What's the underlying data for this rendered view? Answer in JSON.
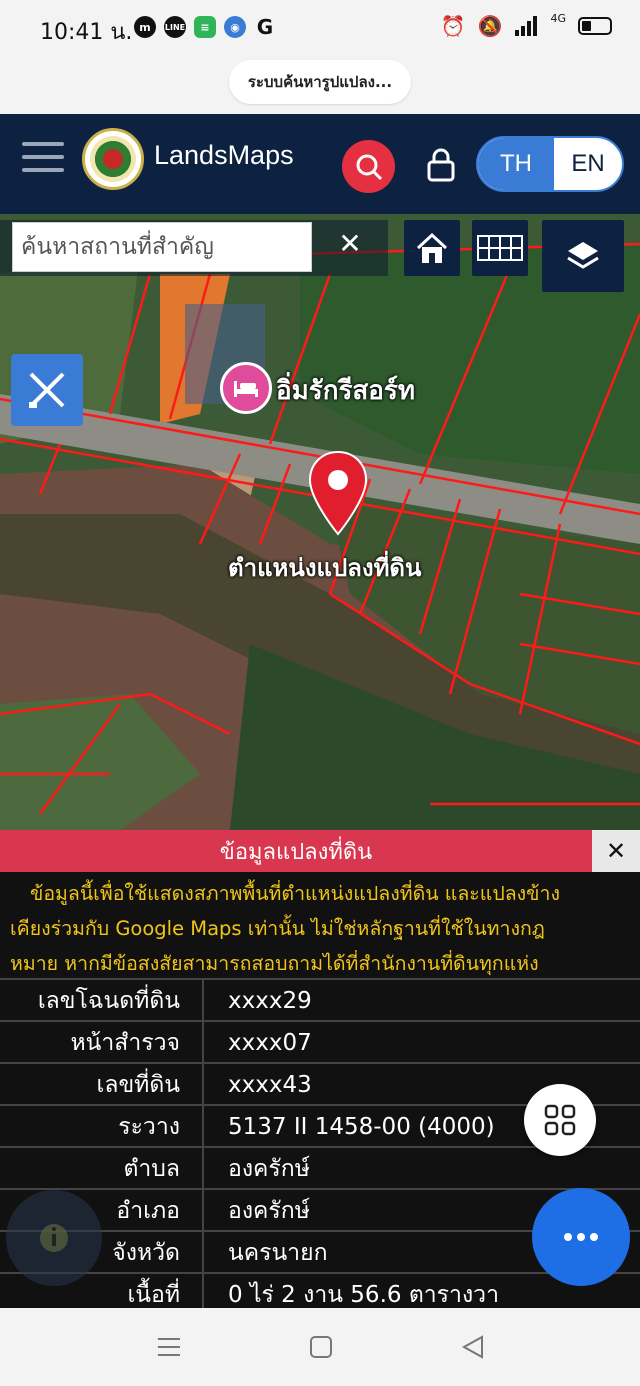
{
  "status_bar": {
    "time": "10:41 น.",
    "app_icons": [
      "messenger-icon",
      "line-icon",
      "messages-icon",
      "browser-icon",
      "google-icon"
    ],
    "network": "4G"
  },
  "browser": {
    "url_title": "ระบบค้นหารูปแปลง..."
  },
  "header": {
    "brand": "LandsMaps",
    "lang_th": "TH",
    "lang_en": "EN"
  },
  "map": {
    "search_placeholder": "ค้นหาสถานที่สำคัญ",
    "clear_label": "✕",
    "poi_label": "อิ่มรักรีสอร์ท",
    "pin_label": "ตำแหน่งแปลงที่ดิน"
  },
  "panel": {
    "title": "ข้อมูลแปลงที่ดิน",
    "close_label": "✕",
    "notice_lines": [
      "ข้อมูลนี้เพื่อใช้แสดงสภาพพื้นที่ตำแหน่งแปลงที่ดิน และแปลงข้าง",
      "เคียงร่วมกับ Google Maps เท่านั้น ไม่ใช่หลักฐานที่ใช้ในทางกฎ",
      "หมาย หากมีข้อสงสัยสามารถสอบถามได้ที่สำนักงานที่ดินทุกแห่ง"
    ],
    "rows": [
      {
        "label": "เลขโฉนดที่ดิน",
        "value": "xxxx29"
      },
      {
        "label": "หน้าสำรวจ",
        "value": "xxxx07"
      },
      {
        "label": "เลขที่ดิน",
        "value": "xxxx43"
      },
      {
        "label": "ระวาง",
        "value": "5137 II 1458-00 (4000)"
      },
      {
        "label": "ตำบล",
        "value": "องครักษ์"
      },
      {
        "label": "อำเภอ",
        "value": "องครักษ์"
      },
      {
        "label": "จังหวัด",
        "value": "นครนายก"
      },
      {
        "label": "เนื้อที่",
        "value": "0 ไร่ 2 งาน 56.6 ตารางวา"
      }
    ]
  },
  "colors": {
    "header_bg": "#0d2240",
    "accent_blue": "#3a7bd5",
    "search_red": "#e53041",
    "panel_title_red": "#d9374f",
    "notice_yellow": "#f0c419",
    "parcel_line_red": "#ff1a1a"
  }
}
